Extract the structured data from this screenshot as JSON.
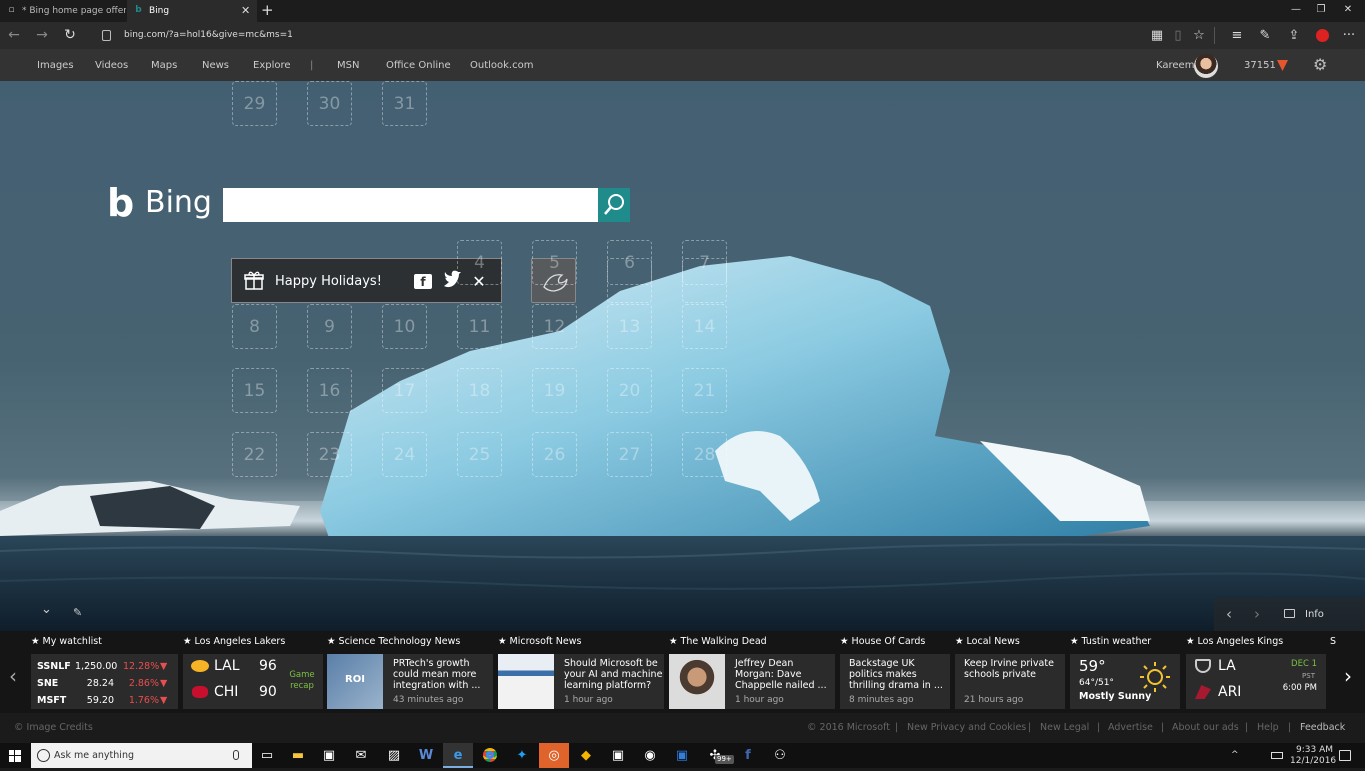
{
  "browser": {
    "tabs": [
      {
        "label": "* Bing home page offers up",
        "icon": "page-icon"
      },
      {
        "label": "Bing",
        "icon": "bing-icon",
        "close": "✕"
      }
    ],
    "new_tab": "+",
    "window": {
      "minimize": "—",
      "restore": "❐",
      "close": "✕"
    },
    "url": "bing.com/?a=hol16&give=mc&ms=1",
    "back": "←",
    "forward": "→",
    "refresh": "↻",
    "toolbar": {
      "star": "☆",
      "hub": "≡",
      "note": "✎",
      "share": "⚠",
      "more": "···"
    }
  },
  "bing_nav": {
    "left": [
      "Images",
      "Videos",
      "Maps",
      "News",
      "Explore"
    ],
    "divider": "|",
    "right": [
      "MSN",
      "Office Online",
      "Outlook.com"
    ],
    "user": "Kareem",
    "points": "37151"
  },
  "search": {
    "logo_text": "Bing",
    "logo_b": "b",
    "placeholder": ""
  },
  "holiday": {
    "text": "Happy Holidays!",
    "fb": "f",
    "close": "✕"
  },
  "calendar_days": [
    "4",
    "5",
    "6",
    "7",
    "8",
    "9",
    "10",
    "11",
    "12",
    "13",
    "14",
    "15",
    "16",
    "17",
    "18",
    "19",
    "20",
    "21",
    "22",
    "23",
    "24",
    "25",
    "26",
    "27",
    "28",
    "29",
    "30",
    "31"
  ],
  "hero_controls": {
    "collapse": "⌄",
    "edit": "✎",
    "prev": "‹",
    "next": "›",
    "info": "Info"
  },
  "feed": {
    "watchlist": {
      "title": "My watchlist",
      "stocks": [
        {
          "symbol": "SSNLF",
          "price": "1,250.00",
          "change": "12.28%"
        },
        {
          "symbol": "SNE",
          "price": "28.24",
          "change": "2.86%"
        },
        {
          "symbol": "MSFT",
          "price": "59.20",
          "change": "1.76%"
        }
      ]
    },
    "lakers": {
      "title": "Los Angeles Lakers",
      "team1": "LAL",
      "score1": "96",
      "team2": "CHI",
      "score2": "90",
      "status": "Game recap"
    },
    "news": [
      {
        "title_hd": "Science Technology News",
        "headline": "PRTech's growth could mean more integration with ...",
        "time": "43 minutes ago",
        "img_text": "ROI"
      },
      {
        "title_hd": "Microsoft News",
        "headline": "Should Microsoft be your AI and machine learning platform?",
        "time": "1 hour ago",
        "img_text": ""
      },
      {
        "title_hd": "The Walking Dead",
        "headline": "Jeffrey Dean Morgan: Dave Chappelle nailed ...",
        "time": "1 hour ago",
        "img_text": ""
      }
    ],
    "house_of_cards": {
      "title": "House Of Cards",
      "headline": "Backstage UK politics makes thrilling drama in ...",
      "time": "8 minutes ago"
    },
    "local_news": {
      "title": "Local News",
      "headline": "Keep Irvine private schools private",
      "time": "21 hours ago"
    },
    "weather": {
      "title": "Tustin weather",
      "temp": "59°",
      "range": "64°/51°",
      "cond": "Mostly Sunny"
    },
    "kings": {
      "title": "Los Angeles Kings",
      "team1": "LA",
      "team2": "ARI",
      "date": "DEC 1",
      "tz": "PST",
      "time": "6:00 PM"
    },
    "partial": "S",
    "prev": "‹",
    "next": "›"
  },
  "footer": {
    "credits": "© Image Credits",
    "copyright": "© 2016 Microsoft",
    "links": [
      "New Privacy and Cookies",
      "New Legal",
      "Advertise",
      "About our ads",
      "Help"
    ],
    "separators": [
      "|",
      "|",
      "|",
      "|",
      "|",
      "|"
    ],
    "feedback": "Feedback"
  },
  "taskbar": {
    "search_placeholder": "Ask me anything",
    "time": "9:33 AM",
    "date": "12/1/2016",
    "badge": "99+",
    "tray_up": "^"
  },
  "colors": {
    "accent": "#1f8b8b",
    "stock_down": "#e94e4e",
    "game_recap": "#7bc043",
    "sun": "#f4c430"
  }
}
